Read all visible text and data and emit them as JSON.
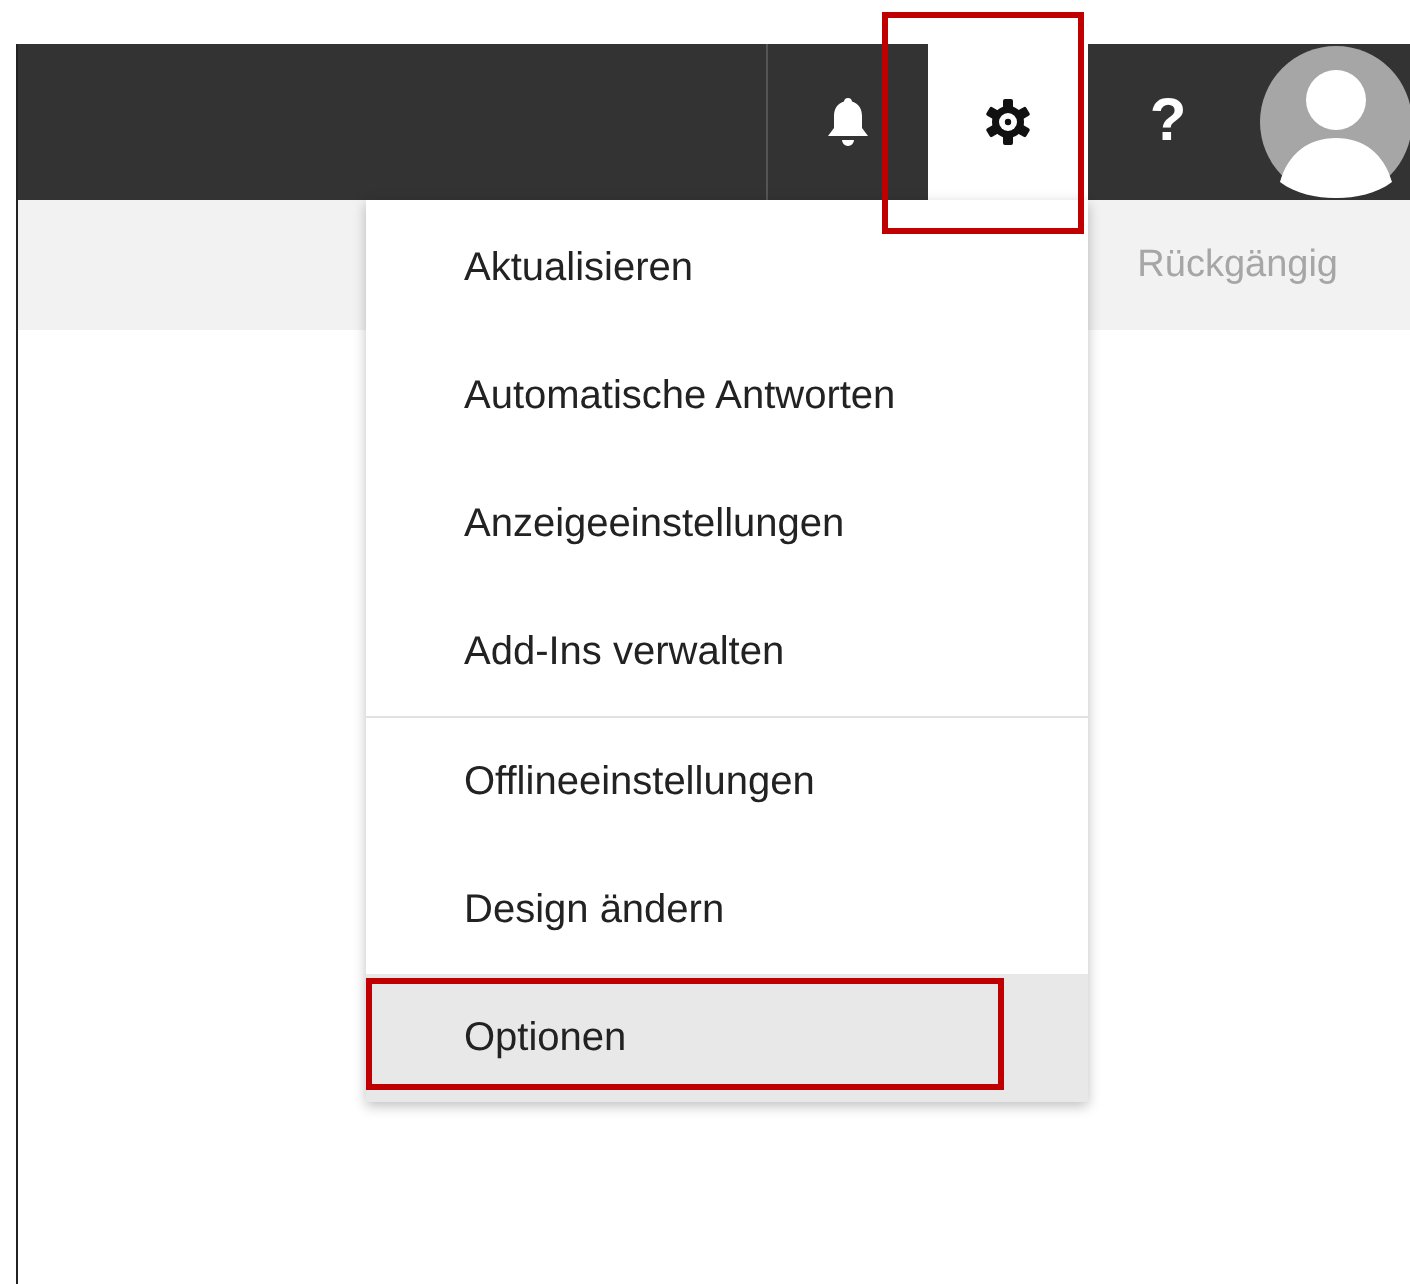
{
  "top_bar": {
    "buttons": [
      {
        "kind": "bell",
        "selected": false,
        "highlighted": false
      },
      {
        "kind": "gear",
        "selected": true,
        "highlighted": true
      },
      {
        "kind": "help",
        "label": "?",
        "selected": false,
        "highlighted": false
      }
    ]
  },
  "command_bar": {
    "undo": {
      "label": "Rückgängig",
      "disabled": true
    }
  },
  "settings_menu": {
    "sections": [
      {
        "items": [
          {
            "label": "Aktualisieren",
            "selected": false,
            "highlighted": false
          },
          {
            "label": "Automatische Antworten",
            "selected": false,
            "highlighted": false
          },
          {
            "label": "Anzeigeeinstellungen",
            "selected": false,
            "highlighted": false
          },
          {
            "label": "Add-Ins verwalten",
            "selected": false,
            "highlighted": false
          }
        ]
      },
      {
        "items": [
          {
            "label": "Offlineeinstellungen",
            "selected": false,
            "highlighted": false
          },
          {
            "label": "Design ändern",
            "selected": false,
            "highlighted": false
          },
          {
            "label": "Optionen",
            "selected": true,
            "highlighted": true
          }
        ]
      }
    ]
  }
}
